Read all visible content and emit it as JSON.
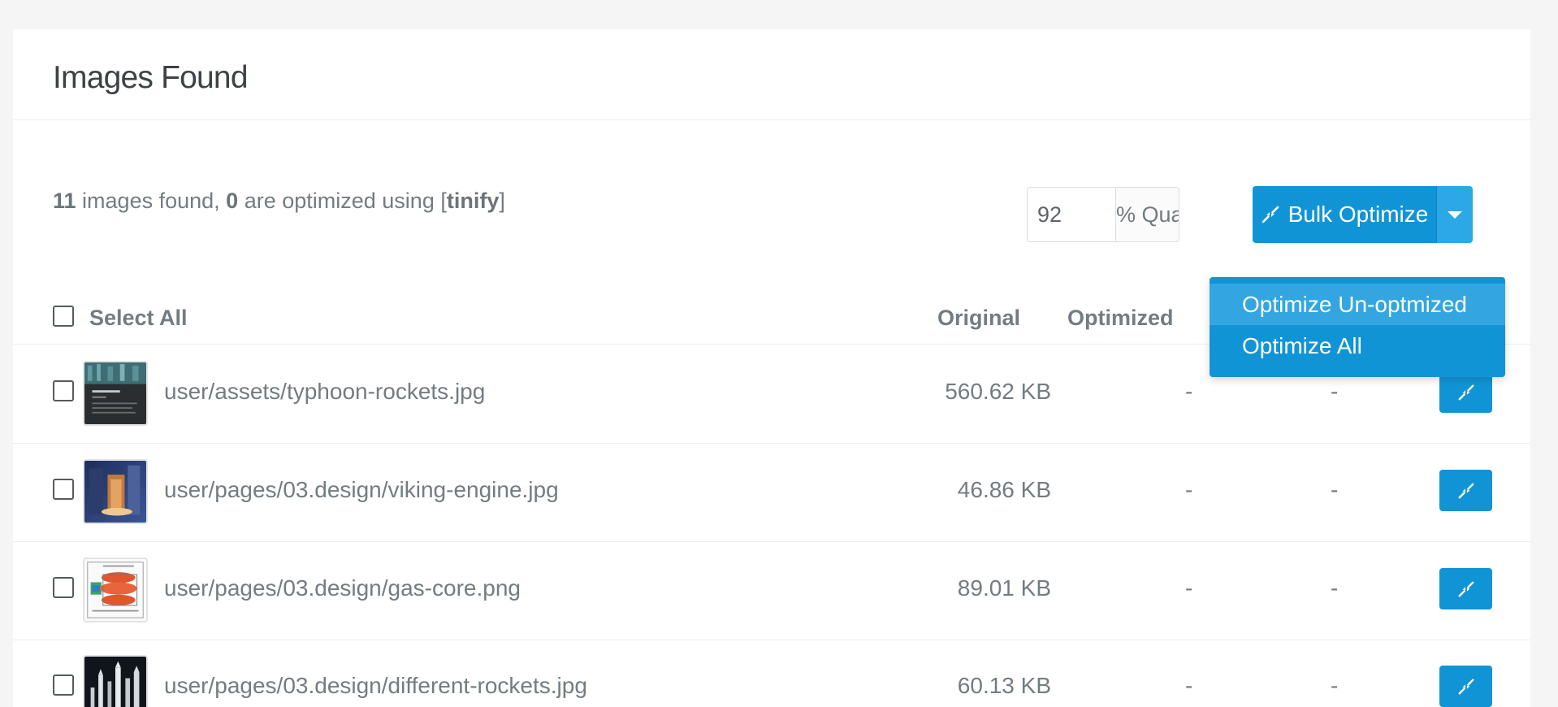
{
  "panel": {
    "title": "Images Found"
  },
  "summary": {
    "count": "11",
    "text_a": " images found, ",
    "optimized": "0",
    "text_b": " are optimized using [",
    "engine": "tinify",
    "text_c": "]"
  },
  "quality": {
    "value": "92",
    "addon": "% Quality"
  },
  "bulk": {
    "label": "Bulk Optimize",
    "icon": "compress-icon",
    "color": "#1194d6"
  },
  "dropdown": {
    "items": [
      "Optimize Un-optmized",
      "Optimize All"
    ]
  },
  "table": {
    "select_all": "Select All",
    "col_original": "Original",
    "col_optimized": "Optimized"
  },
  "rows": [
    {
      "path": "user/assets/typhoon-rockets.jpg",
      "original": "560.62 KB",
      "optimized": "-",
      "saved": "-"
    },
    {
      "path": "user/pages/03.design/viking-engine.jpg",
      "original": "46.86 KB",
      "optimized": "-",
      "saved": "-"
    },
    {
      "path": "user/pages/03.design/gas-core.png",
      "original": "89.01 KB",
      "optimized": "-",
      "saved": "-"
    },
    {
      "path": "user/pages/03.design/different-rockets.jpg",
      "original": "60.13 KB",
      "optimized": "-",
      "saved": "-"
    }
  ]
}
